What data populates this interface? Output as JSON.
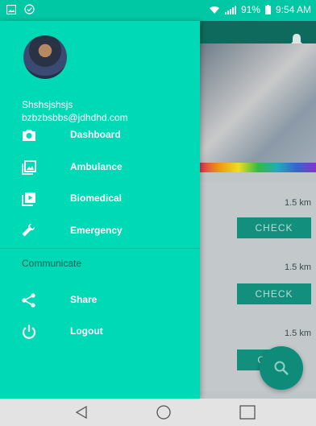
{
  "status_bar": {
    "signal": "91%",
    "time": "9:54 AM",
    "left_icons": [
      "image-icon",
      "check-circle-icon"
    ]
  },
  "drawer": {
    "user_name": "Shshsjshsjs",
    "user_email": "bzbzbsbbs@jdhdhd.com",
    "menu": [
      {
        "label": "Dashboard",
        "icon": "camera-icon"
      },
      {
        "label": "Ambulance",
        "icon": "gallery-icon"
      },
      {
        "label": "Biomedical",
        "icon": "video-icon"
      },
      {
        "label": "Emergency",
        "icon": "wrench-icon"
      }
    ],
    "section_title": "Communicate",
    "communicate": [
      {
        "label": "Share",
        "icon": "share-icon"
      },
      {
        "label": "Logout",
        "icon": "power-icon"
      }
    ]
  },
  "behind": {
    "cards": [
      {
        "distance": "1.5 km",
        "button": "CHECK"
      },
      {
        "distance": "1.5 km",
        "button": "CHECK"
      },
      {
        "distance": "1.5 km",
        "button": "CH"
      }
    ]
  },
  "colors": {
    "drawer_bg": "#00d9b5",
    "status_bg": "#00c7a4",
    "check_button": "#138f7e"
  }
}
